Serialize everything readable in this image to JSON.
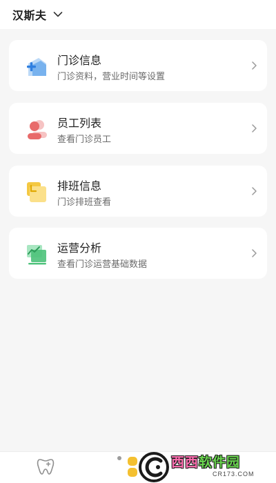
{
  "header": {
    "clinic_name": "汉斯夫"
  },
  "menu": [
    {
      "title": "门诊信息",
      "subtitle": "门诊资料，营业时间等设置",
      "icon": "clinic-info-icon"
    },
    {
      "title": "员工列表",
      "subtitle": "查看门诊员工",
      "icon": "staff-icon"
    },
    {
      "title": "排班信息",
      "subtitle": "门诊排班查看",
      "icon": "schedule-icon"
    },
    {
      "title": "运营分析",
      "subtitle": "查看门诊运营基础数据",
      "icon": "analytics-icon"
    }
  ],
  "tabbar": {
    "tabs": [
      "tooth-icon",
      "apps-icon",
      "user-icon"
    ]
  },
  "watermark": {
    "brand_part1": "西西",
    "brand_part2": "软件园",
    "url": "CR173.COM"
  },
  "colors": {
    "accent_blue": "#4a90e2",
    "accent_red": "#e86a6a",
    "accent_yellow": "#f4c842",
    "accent_green": "#4cc27a"
  }
}
